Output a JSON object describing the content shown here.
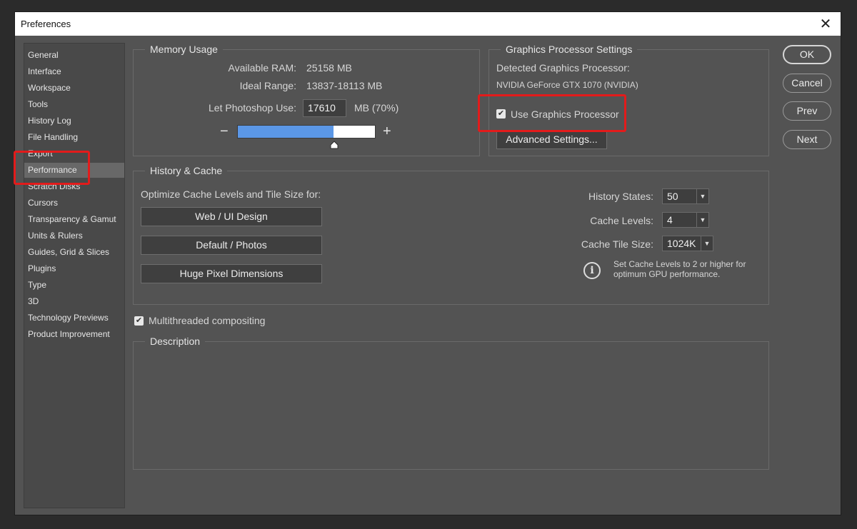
{
  "window": {
    "title": "Preferences"
  },
  "sidebar": {
    "items": [
      {
        "label": "General"
      },
      {
        "label": "Interface"
      },
      {
        "label": "Workspace"
      },
      {
        "label": "Tools"
      },
      {
        "label": "History Log"
      },
      {
        "label": "File Handling"
      },
      {
        "label": "Export"
      },
      {
        "label": "Performance"
      },
      {
        "label": "Scratch Disks"
      },
      {
        "label": "Cursors"
      },
      {
        "label": "Transparency & Gamut"
      },
      {
        "label": "Units & Rulers"
      },
      {
        "label": "Guides, Grid & Slices"
      },
      {
        "label": "Plugins"
      },
      {
        "label": "Type"
      },
      {
        "label": "3D"
      },
      {
        "label": "Technology Previews"
      },
      {
        "label": "Product Improvement"
      }
    ],
    "selected": "Performance"
  },
  "memory": {
    "title": "Memory Usage",
    "available_label": "Available RAM:",
    "available_value": "25158 MB",
    "ideal_label": "Ideal Range:",
    "ideal_value": "13837-18113 MB",
    "let_label": "Let Photoshop Use:",
    "let_value": "17610",
    "let_unit": "MB (70%)",
    "slider_percent": 70,
    "minus": "−",
    "plus": "+"
  },
  "gpu": {
    "title": "Graphics Processor Settings",
    "detected_label": "Detected Graphics Processor:",
    "detected_value": "NVIDIA GeForce GTX 1070 (NVIDIA)",
    "use_label": "Use Graphics Processor",
    "use_checked": true,
    "advanced_label": "Advanced Settings..."
  },
  "history_cache": {
    "title": "History & Cache",
    "optimize_label": "Optimize Cache Levels and Tile Size for:",
    "buttons": [
      "Web / UI Design",
      "Default / Photos",
      "Huge Pixel Dimensions"
    ],
    "history_states_label": "History States:",
    "history_states_value": "50",
    "cache_levels_label": "Cache Levels:",
    "cache_levels_value": "4",
    "tile_size_label": "Cache Tile Size:",
    "tile_size_value": "1024K",
    "info_line1": "Set Cache Levels to 2 or higher for",
    "info_line2": "optimum GPU performance."
  },
  "multithreaded": {
    "label": "Multithreaded compositing",
    "checked": true
  },
  "description": {
    "title": "Description"
  },
  "actions": {
    "ok": "OK",
    "cancel": "Cancel",
    "prev": "Prev",
    "next": "Next"
  },
  "icons": {
    "close": "close-icon",
    "check": "checkmark-icon",
    "info": "info-icon",
    "chevron": "chevron-down-icon"
  },
  "colors": {
    "highlight": "#e31b1b",
    "slider_fill": "#5b97e6",
    "panel_bg": "#535353"
  }
}
